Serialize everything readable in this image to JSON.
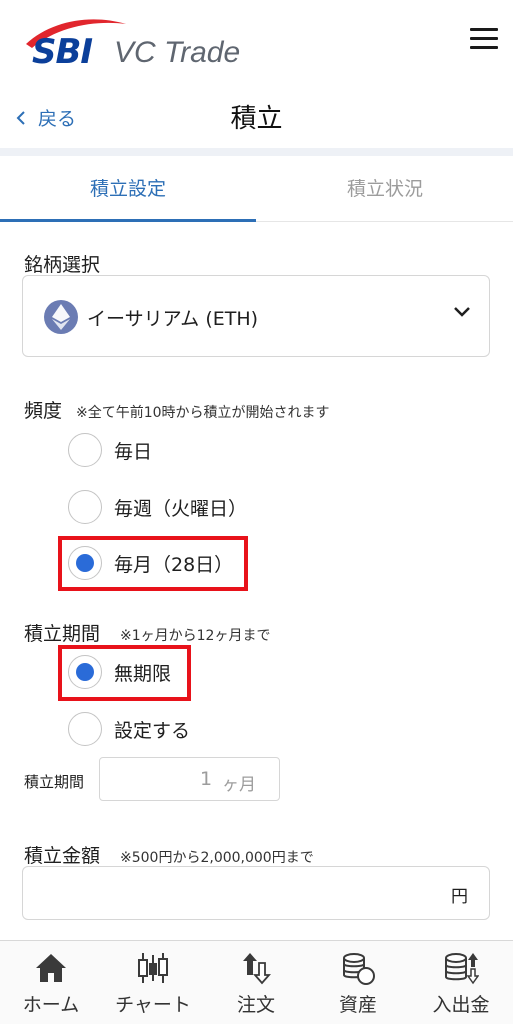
{
  "brand": {
    "logo_sbi": "SBI",
    "logo_sub": "VC Trade",
    "logo_accent": "#e1262d",
    "logo_primary": "#0b3f9a"
  },
  "header": {
    "menu_icon": "hamburger-menu-icon"
  },
  "navbar": {
    "back_label": "戻る",
    "title": "積立"
  },
  "tabs": [
    {
      "label": "積立設定",
      "active": true
    },
    {
      "label": "積立状況",
      "active": false
    }
  ],
  "coin_select": {
    "label": "銘柄選択",
    "value": "イーサリアム (ETH)",
    "icon": "ethereum-icon"
  },
  "frequency": {
    "label": "頻度",
    "note": "※全て午前10時から積立が開始されます",
    "options": [
      {
        "label": "毎日",
        "checked": false
      },
      {
        "label": "毎週（火曜日）",
        "checked": false
      },
      {
        "label": "毎月（28日）",
        "checked": true
      }
    ]
  },
  "period": {
    "label": "積立期間",
    "note": "※1ヶ月から12ヶ月まで",
    "options": [
      {
        "label": "無期限",
        "checked": true
      },
      {
        "label": "設定する",
        "checked": false
      }
    ],
    "months_label": "積立期間",
    "months_value": "1",
    "months_unit": "ヶ月"
  },
  "amount": {
    "label": "積立金額",
    "note": "※500円から2,000,000円まで",
    "value": "",
    "unit": "円"
  },
  "bottom_nav": [
    {
      "label": "ホーム",
      "icon": "home-icon"
    },
    {
      "label": "チャート",
      "icon": "candlestick-chart-icon"
    },
    {
      "label": "注文",
      "icon": "order-arrows-icon"
    },
    {
      "label": "資産",
      "icon": "coins-stack-icon"
    },
    {
      "label": "入出金",
      "icon": "deposit-withdraw-icon"
    }
  ],
  "colors": {
    "accent": "#2d6fb6",
    "radio_checked": "#2a6bd8",
    "highlight": "#e8121a"
  }
}
